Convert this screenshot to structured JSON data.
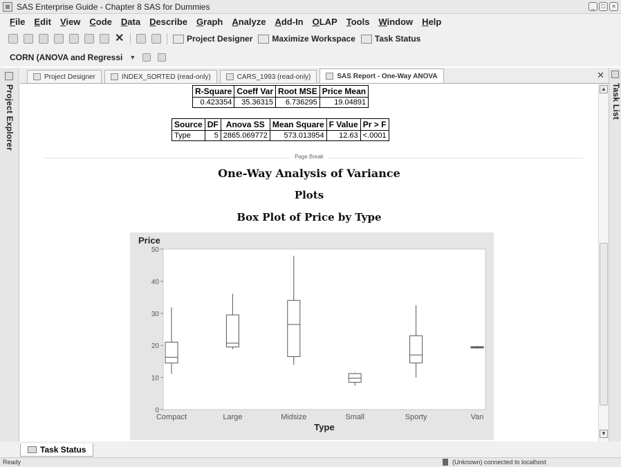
{
  "window": {
    "title": "SAS Enterprise Guide - Chapter 8 SAS for Dummies",
    "controls": [
      "_",
      "□",
      "×"
    ]
  },
  "menu": [
    "File",
    "Edit",
    "View",
    "Code",
    "Data",
    "Describe",
    "Graph",
    "Analyze",
    "Add-In",
    "OLAP",
    "Tools",
    "Window",
    "Help"
  ],
  "toolbar": {
    "project_designer": "Project Designer",
    "maximize_workspace": "Maximize Workspace",
    "task_status": "Task Status",
    "project_combo": "CORN (ANOVA and Regressi"
  },
  "panels": {
    "left": "Project Explorer",
    "right": "Task List"
  },
  "tabs": [
    {
      "label": "Project Designer",
      "active": false
    },
    {
      "label": "INDEX_SORTED (read-only)",
      "active": false
    },
    {
      "label": "CARS_1993 (read-only)",
      "active": false
    },
    {
      "label": "SAS Report - One-Way ANOVA",
      "active": true
    }
  ],
  "fit_stats": {
    "headers": [
      "R-Square",
      "Coeff Var",
      "Root MSE",
      "Price Mean"
    ],
    "row": [
      "0.423354",
      "35.36315",
      "6.736295",
      "19.04891"
    ]
  },
  "anova_table": {
    "headers": [
      "Source",
      "DF",
      "Anova SS",
      "Mean Square",
      "F Value",
      "Pr > F"
    ],
    "row": [
      "Type",
      "5",
      "2865.069772",
      "573.013954",
      "12.63",
      "<.0001"
    ]
  },
  "page_break_label": "Page Break",
  "headings": {
    "h1": "One-Way Analysis of Variance",
    "h2": "Plots",
    "h3": "Box Plot of Price by Type"
  },
  "chart_data": {
    "type": "boxplot",
    "title": "Box Plot of Price by Type",
    "xlabel": "Type",
    "ylabel": "Price",
    "ylim": [
      0,
      50
    ],
    "yticks": [
      0,
      10,
      20,
      30,
      40,
      50
    ],
    "categories": [
      "Compact",
      "Large",
      "Midsize",
      "Small",
      "Sporty",
      "Van"
    ],
    "boxes": [
      {
        "category": "Compact",
        "min": 11.1,
        "q1": 14.5,
        "median": 16.3,
        "q3": 21.0,
        "max": 31.9
      },
      {
        "category": "Large",
        "min": 18.8,
        "q1": 19.5,
        "median": 20.7,
        "q3": 29.5,
        "max": 36.1
      },
      {
        "category": "Midsize",
        "min": 13.9,
        "q1": 16.5,
        "median": 26.5,
        "q3": 34.0,
        "max": 47.9
      },
      {
        "category": "Small",
        "min": 7.4,
        "q1": 8.5,
        "median": 9.8,
        "q3": 11.2,
        "max": 11.5
      },
      {
        "category": "Sporty",
        "min": 10.0,
        "q1": 14.5,
        "median": 17.0,
        "q3": 23.0,
        "max": 32.5
      },
      {
        "category": "Van",
        "min": 19.0,
        "q1": 19.2,
        "median": 19.4,
        "q3": 19.6,
        "max": 19.8
      }
    ],
    "colors": {
      "box": "#555555",
      "frame_bg": "#e5e5e5",
      "plot_bg": "#ffffff"
    }
  },
  "task_status_tab": "Task Status",
  "status": {
    "left": "Ready",
    "right": "(Unknown) connected to localhost"
  }
}
